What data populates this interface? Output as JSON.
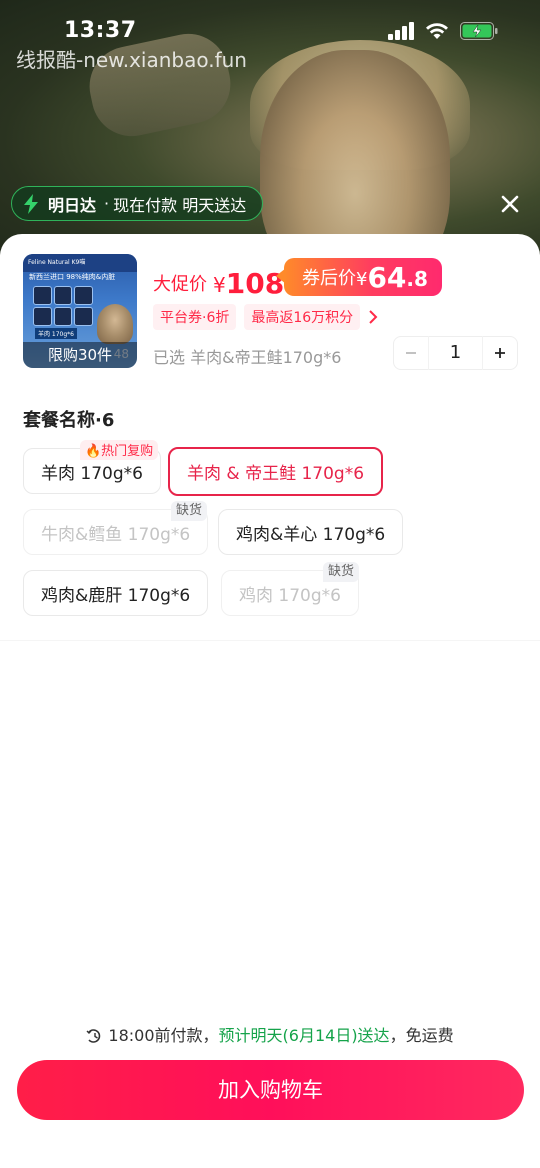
{
  "status_bar": {
    "time": "13:37",
    "watermark": "线报酷-new.xianbao.fun"
  },
  "delivery_badge": {
    "strong": "明日达",
    "dot": "·",
    "text": "现在付款 明天送达"
  },
  "product": {
    "thumbnail": {
      "header": "Feline Natural K9喵",
      "subline": "新西兰进口 98%纯肉&内脏",
      "tag": "羊肉 170g*6",
      "limit": "限购30件",
      "corner": "48"
    },
    "promo_label": "大促价",
    "currency": "¥",
    "promo_price": "108",
    "coupon_label": "券后价",
    "coupon_currency": "¥",
    "coupon_int": "64",
    "coupon_dec": ".8",
    "tags": [
      "平台券·6折",
      "最高返16万积分"
    ],
    "selected": "已选 羊肉&帝王鲑170g*6",
    "quantity": "1"
  },
  "options": {
    "title": "套餐名称·6",
    "hot_badge": "🔥热门复购",
    "out_of_stock": "缺货",
    "items": [
      {
        "label": "羊肉 170g*6",
        "state": "normal"
      },
      {
        "label": "羊肉 & 帝王鲑 170g*6",
        "state": "selected"
      },
      {
        "label": "牛肉&鳕鱼 170g*6",
        "state": "disabled"
      },
      {
        "label": "鸡肉&羊心 170g*6",
        "state": "normal"
      },
      {
        "label": "鸡肉&鹿肝 170g*6",
        "state": "normal"
      },
      {
        "label": "鸡肉 170g*6",
        "state": "disabled"
      }
    ]
  },
  "footer": {
    "time_note": "18:00前付款，",
    "green_note": "预计明天(6月14日)送达",
    "tail_note": "，免运费",
    "cart_button": "加入购物车"
  },
  "colors": {
    "accent": "#ff1e3c",
    "selected_border": "#e7244a",
    "delivery_green": "#15a34a"
  }
}
